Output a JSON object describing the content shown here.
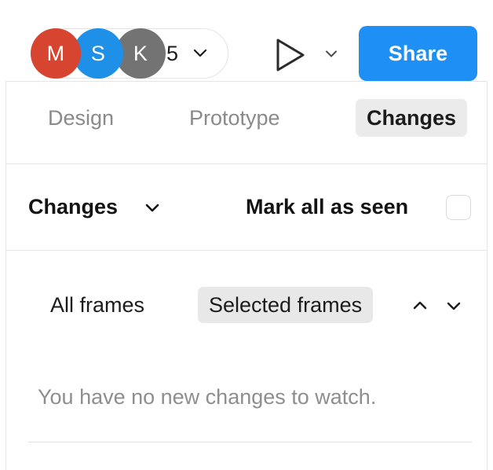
{
  "topbar": {
    "avatars": [
      {
        "initial": "M",
        "color": "#d7442f",
        "name": "avatar-m"
      },
      {
        "initial": "S",
        "color": "#1e90e8",
        "name": "avatar-s"
      },
      {
        "initial": "K",
        "color": "#737373",
        "name": "avatar-k"
      }
    ],
    "collaborator_count": "5",
    "count_caret_icon": "chevron-down-icon",
    "present_icon": "play-icon",
    "present_caret_icon": "chevron-down-icon",
    "share_label": "Share",
    "share_color": "#1e90f5"
  },
  "tabs": [
    {
      "label": "Design",
      "active": false
    },
    {
      "label": "Prototype",
      "active": false
    },
    {
      "label": "Changes",
      "active": true
    }
  ],
  "changes_header": {
    "title": "Changes",
    "title_caret_icon": "chevron-down-icon",
    "mark_all_label": "Mark all as seen",
    "mark_all_checked": false,
    "checkbox_icon": "checkbox-empty-icon"
  },
  "frames_filter": {
    "all_frames_label": "All frames",
    "selected_frames_label": "Selected frames",
    "selected": "Selected frames",
    "prev_icon": "chevron-up-icon",
    "next_icon": "chevron-down-icon"
  },
  "content": {
    "empty_message": "You have no new changes to watch."
  },
  "colors": {
    "accent": "#1e90f5",
    "active_tab_bg": "#ebebeb",
    "pill_bg": "#e8e8e8",
    "border": "#e5e5e5",
    "muted_text": "#8a8a8a"
  }
}
